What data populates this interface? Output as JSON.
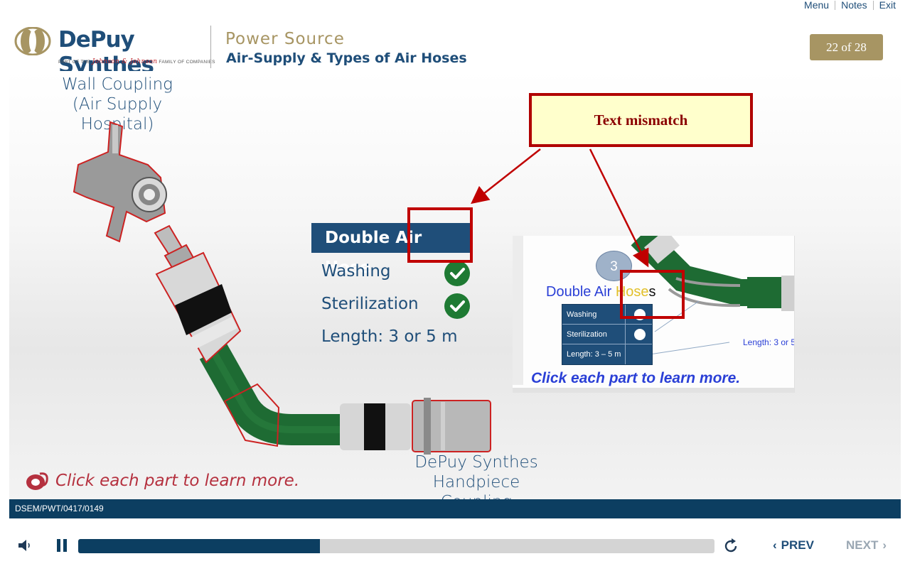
{
  "topnav": {
    "menu": "Menu",
    "notes": "Notes",
    "exit": "Exit"
  },
  "header": {
    "logo_text": "DePuy Synthes",
    "logo_tagline_pre": "PART OF THE",
    "logo_tagline_brand": "Johnson & Johnson",
    "logo_tagline_post": "FAMILY OF COMPANIES",
    "title": "Power Source",
    "subtitle": "Air-Supply & Types of Air Hoses",
    "page_indicator": "22 of 28"
  },
  "stage": {
    "caption_wall": [
      "Wall Coupling",
      "(Air Supply Hospital)"
    ],
    "caption_handpiece": [
      "DePuy Synthes",
      "Handpiece Coupling"
    ],
    "panel": {
      "heading": "Double Air Hose",
      "rows": [
        {
          "label": "Washing",
          "checked": true
        },
        {
          "label": "Sterilization",
          "checked": true
        },
        {
          "label": "Length: 3 or 5 m",
          "checked": false
        }
      ]
    },
    "call_to_action": "Click each part to learn more."
  },
  "annotation": {
    "callout_text": "Text mismatch",
    "colors": {
      "border": "#b00000",
      "fill": "#ffffcc"
    }
  },
  "inset": {
    "badge_number": "3",
    "title_blue": "Double Air ",
    "title_yellow": "Hose",
    "title_black": "s",
    "table": [
      "Washing",
      "Sterilization",
      "Length: 3 – 5 m"
    ],
    "length_label": "Length: 3 or 5",
    "call_to_action": "Click each part to learn more."
  },
  "footer": {
    "code": "DSEM/PWT/0417/0149",
    "progress_fraction": 0.38,
    "prev_label": "PREV",
    "next_label": "NEXT"
  },
  "colors": {
    "brand_blue": "#1f4e79",
    "gold": "#a79563",
    "dark_bar": "#0c3e61",
    "hose_green": "#1e6b33"
  }
}
